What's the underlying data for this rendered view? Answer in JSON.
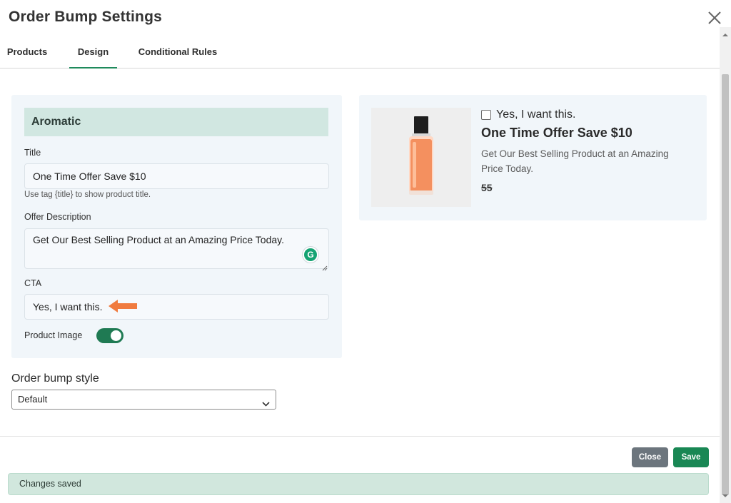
{
  "modal": {
    "title": "Order Bump Settings"
  },
  "tabs": [
    {
      "label": "Products"
    },
    {
      "label": "Design"
    },
    {
      "label": "Conditional Rules"
    }
  ],
  "form": {
    "product_name": "Aromatic",
    "title_label": "Title",
    "title_value": "One Time Offer Save $10",
    "title_help": "Use tag {title} to show product title.",
    "description_label": "Offer Description",
    "description_value": "Get Our Best Selling Product at an Amazing Price Today.",
    "cta_label": "CTA",
    "cta_value": "Yes, I want this.",
    "product_image_label": "Product Image",
    "product_image_enabled": true
  },
  "style": {
    "label": "Order bump style",
    "selected": "Default"
  },
  "preview": {
    "cta": "Yes, I want this.",
    "title": "One Time Offer Save $10",
    "description": "Get Our Best Selling Product at an Amazing Price Today.",
    "price": "55",
    "image_icon": "perfume-bottle-icon"
  },
  "footer": {
    "close_label": "Close",
    "save_label": "Save",
    "status_message": "Changes saved"
  },
  "colors": {
    "accent": "#198754",
    "product_bar": "#d1e7e1",
    "panel_bg": "#f1f6fa",
    "arrow": "#f07b3f"
  }
}
